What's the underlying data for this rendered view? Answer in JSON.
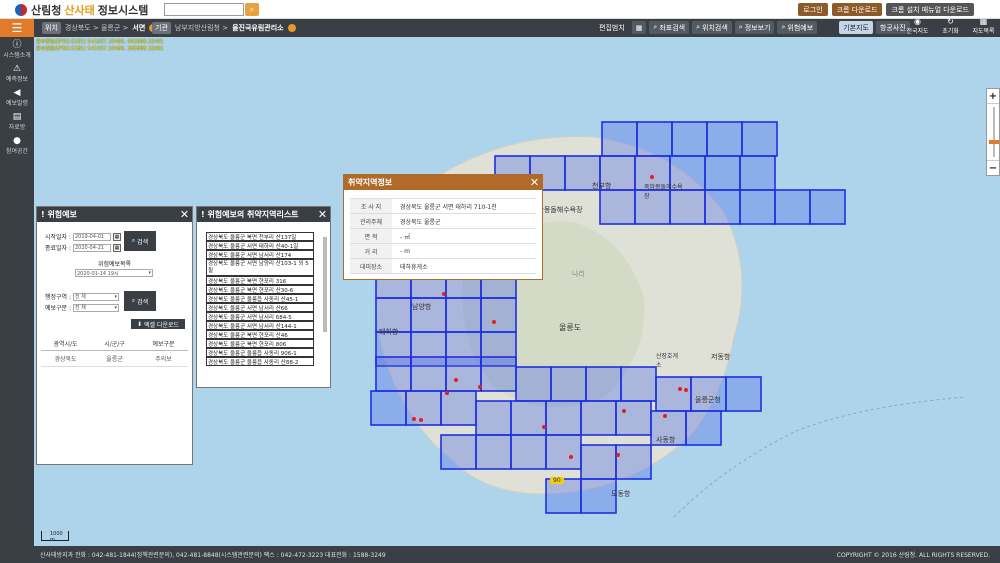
{
  "header": {
    "logo_agency": "산림청",
    "logo_title_accent": "산사태",
    "logo_title_rest": "정보시스템",
    "search_placeholder": "",
    "buttons": {
      "login": "로그인",
      "chrome_download": "크롬 다운로드",
      "chrome_manual": "크롬 설치 매뉴얼 다운로드"
    }
  },
  "navbar": {
    "location_tag": "위치",
    "location_path": "경상북도 > 울릉군 >",
    "location_current": "서면",
    "agency_tag": "기관",
    "agency_path": "남부지방산림청 >",
    "agency_current": "울진국유림관리소",
    "tools": [
      "편집범치",
      "좌표검색",
      "위치검색",
      "정보보기",
      "위험예보"
    ],
    "map_types": [
      "기본지도",
      "항공사진"
    ],
    "icons": [
      {
        "icon": "eye-icon",
        "label": "전국지도"
      },
      {
        "icon": "refresh-icon",
        "label": "초기화"
      },
      {
        "icon": "grid-icon",
        "label": "지도목록"
      }
    ]
  },
  "sidebar": {
    "items": [
      {
        "icon": "info-icon",
        "label": "시스템소개"
      },
      {
        "icon": "alarm-icon",
        "label": "예측정보"
      },
      {
        "icon": "speaker-icon",
        "label": "예보발령"
      },
      {
        "icon": "document-icon",
        "label": "자료방"
      },
      {
        "icon": "chat-icon",
        "label": "참여공간"
      }
    ]
  },
  "map": {
    "coord_lines": [
      "중부원점(EPSG:5181) 541037.10460, 402888.32401",
      "중부원점(EPSG:5181) 541037.10460, 385888.32401"
    ],
    "labels": {
      "island": "울릉도",
      "harbor": "저동항",
      "office": "울릉군청",
      "jukdo": "죽암몽돌해수욕장",
      "port": "도동항",
      "cheonbu": "천부항",
      "sanggang": "추산몽돌해수욕장",
      "hamabiam": "사동항",
      "namyang": "남양항",
      "taeha": "태하항",
      "route": "90",
      "nari": "나리",
      "jeodong2": "산장호게소"
    },
    "scale": "1000 m",
    "zoom_in": "+",
    "zoom_out": "−"
  },
  "forecast_panel": {
    "title": "위험예보",
    "close": "✕",
    "start_label": "시작일자 :",
    "start_value": "2019-04-01",
    "end_label": "종료일자 :",
    "end_value": "2020-04-21",
    "search_label": "검색",
    "list_title": "위험예보목록",
    "list_selected": "2020-01-14 19시",
    "region_label": "행정구역 :",
    "region_value": "전 체",
    "type_label": "예보구분 :",
    "type_value": "전 체",
    "search2_label": "검색",
    "excel_label": "엑셀 다운로드",
    "table_headers": [
      "광역시/도",
      "시/군/구",
      "예보구분"
    ],
    "table_rows": [
      [
        "경상북도",
        "울릉군",
        "주의보"
      ]
    ]
  },
  "list_panel": {
    "title": "위험예보의 취약지역리스트",
    "close": "✕",
    "items": [
      "경상북도 울릉군 북면 천부리 산137일",
      "경상북도 울릉군 서면 태하리 산40-1일",
      "경상북도 울릉군 서면 남서리 산174",
      "경상북도 울릉군 서면 남양리 산103-1 외 5필",
      "경상북도 울릉군 북면 현포리 316",
      "경상북도 울릉군 북면 현포리 산30-6",
      "경상북도 울릉군 울릉읍 사동리 산45-1",
      "경상북도 울릉군 서면 남서리 산66",
      "경상북도 울릉군 서면 남서리 684-5",
      "경상북도 울릉군 서면 남서리 산144-1",
      "경상북도 울릉군 북면 현포리 산46",
      "경상북도 울릉군 북면 현포리 806",
      "경상북도 울릉군 울릉읍 사동리 906-1",
      "경상북도 울릉군 울릉읍 사동리 산88-2"
    ]
  },
  "info_popup": {
    "title": "취약지역정보",
    "close": "✕",
    "rows": [
      {
        "key": "조 사 지",
        "value": "경상북도 울릉군 서면 태하리 710-1천"
      },
      {
        "key": "관리주체",
        "value": "경상북도 울릉군"
      },
      {
        "key": "면 적",
        "value": "- ㎡"
      },
      {
        "key": "거 리",
        "value": "- m"
      },
      {
        "key": "대피장소",
        "value": "태하휴게소"
      }
    ]
  },
  "footer": {
    "left": "산사태방지과 전화 : 042-481-1844(정책관련문의), 042-481-8848(시스템관련문의) 팩스 : 042-472-3223 대표전화 : 1588-3249",
    "right": "COPYRIGHT © 2016 산림청. ALL RIGHTS RESERVED."
  },
  "colors": {
    "accent": "#e07b2a",
    "nav": "#3a3f45",
    "grid": "#1e30e0",
    "marker": "#e02020"
  }
}
